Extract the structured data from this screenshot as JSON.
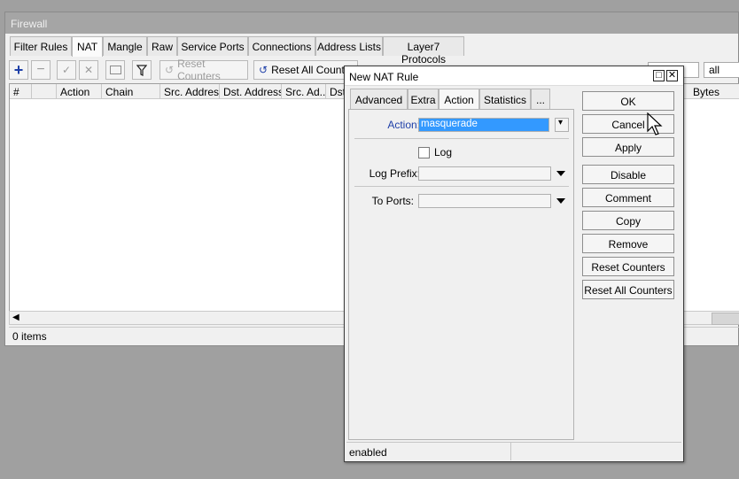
{
  "firewall": {
    "title": "Firewall",
    "tabs": [
      "Filter Rules",
      "NAT",
      "Mangle",
      "Raw",
      "Service Ports",
      "Connections",
      "Address Lists",
      "Layer7 Protocols"
    ],
    "active_tab": "NAT",
    "toolbar": {
      "reset_counters": "Reset Counters",
      "reset_all_counters": "Reset All Counters",
      "filter_value": "all"
    },
    "columns": [
      "#",
      "Action",
      "Chain",
      "Src. Address",
      "Dst. Address",
      "Src. Ad...",
      "Dst.",
      "Bytes"
    ],
    "status": "0 items"
  },
  "dialog": {
    "title": "New NAT Rule",
    "tabs": [
      "Advanced",
      "Extra",
      "Action",
      "Statistics",
      "..."
    ],
    "active_tab": "Action",
    "fields": {
      "action_label": "Action:",
      "action_value": "masquerade",
      "log_label": "Log",
      "log_checked": false,
      "log_prefix_label": "Log Prefix:",
      "log_prefix_value": "",
      "to_ports_label": "To Ports:",
      "to_ports_value": ""
    },
    "buttons": [
      "OK",
      "Cancel",
      "Apply",
      "Disable",
      "Comment",
      "Copy",
      "Remove",
      "Reset Counters",
      "Reset All Counters"
    ],
    "status": "enabled"
  },
  "colors": {
    "selection": "#3399ff",
    "accent_blue": "#1e3fa8"
  }
}
